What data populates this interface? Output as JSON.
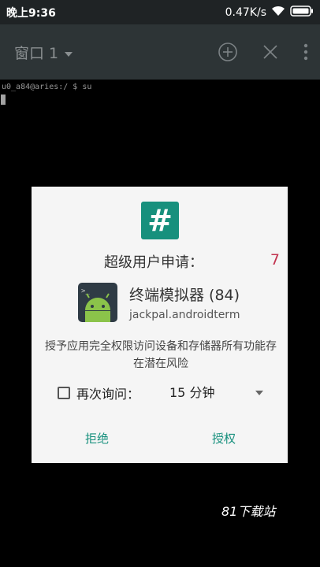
{
  "status_bar": {
    "time": "晚上9:36",
    "net_speed": "0.47K/s"
  },
  "toolbar": {
    "window_title": "窗口 1",
    "icons": [
      "add-window-icon",
      "close-window-icon",
      "more-icon"
    ]
  },
  "terminal": {
    "prompt_line": "u0_a84@aries:/ $ su"
  },
  "dialog": {
    "title_icon": "hash-icon",
    "request_label": "超级用户申请：",
    "request_count": "7",
    "app_name": "终端模拟器 (84)",
    "app_package": "jackpal.androidterm",
    "description": "授予应用完全权限访问设备和存储器所有功能存在潜在风险",
    "ask_again_label": "再次询问：",
    "ask_again_checked": false,
    "duration_value": "15 分钟",
    "deny_label": "拒绝",
    "grant_label": "授权",
    "accent_color": "#17907d",
    "count_color": "#c2334f"
  },
  "watermark": "81下载站"
}
